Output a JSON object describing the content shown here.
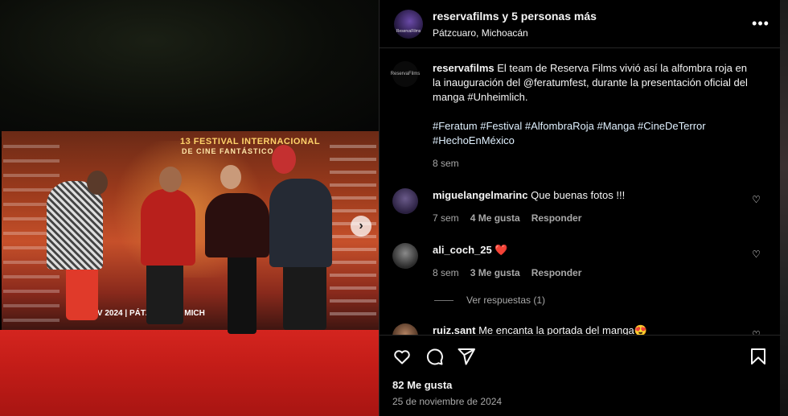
{
  "media": {
    "banner_title": "13 FESTIVAL INTERNACIONAL",
    "banner_subtitle": "DE CINE FANTÁSTICO",
    "banner_date": "13 NOV 2024 | PÁTZCUARO, MICH",
    "next_icon": "chevron-right-icon"
  },
  "header": {
    "title": "reservafilms y 5 personas más",
    "location": "Pátzcuaro, Michoacán",
    "avatar_text": "ReservaFilms",
    "more_icon": "more-horizontal-icon"
  },
  "caption": {
    "username": "reservafilms",
    "text": "El team de Reserva Films vivió así la alfombra roja en la inauguración del @feratumfest, durante la presentación oficial del manga #Unheimlich.",
    "hashtags": "#Feratum #Festival #AlfombraRoja #Manga #CineDeTerror #HechoEnMéxico",
    "time": "8 sem",
    "avatar_text": "ReservaFilms"
  },
  "comments": [
    {
      "username": "miguelangelmarinc",
      "text": "Que buenas fotos !!!",
      "time": "7 sem",
      "likes": "4 Me gusta",
      "reply": "Responder"
    },
    {
      "username": "ali_coch_25",
      "text": "❤️",
      "time": "8 sem",
      "likes": "3 Me gusta",
      "reply": "Responder"
    },
    {
      "username": "ruiz.sant",
      "text": "Me encanta la portada del manga😍"
    }
  ],
  "view_replies": "Ver respuestas (1)",
  "actions": {
    "likes": "82 Me gusta",
    "date": "25 de noviembre de 2024",
    "icons": [
      "heart-icon",
      "comment-icon",
      "share-icon",
      "bookmark-icon"
    ]
  },
  "colors": {
    "background": "#000000",
    "text": "#f5f5f5",
    "muted": "#a8a8a8",
    "hashtag": "#e0f1ff",
    "heart_red": "#ff3040"
  }
}
